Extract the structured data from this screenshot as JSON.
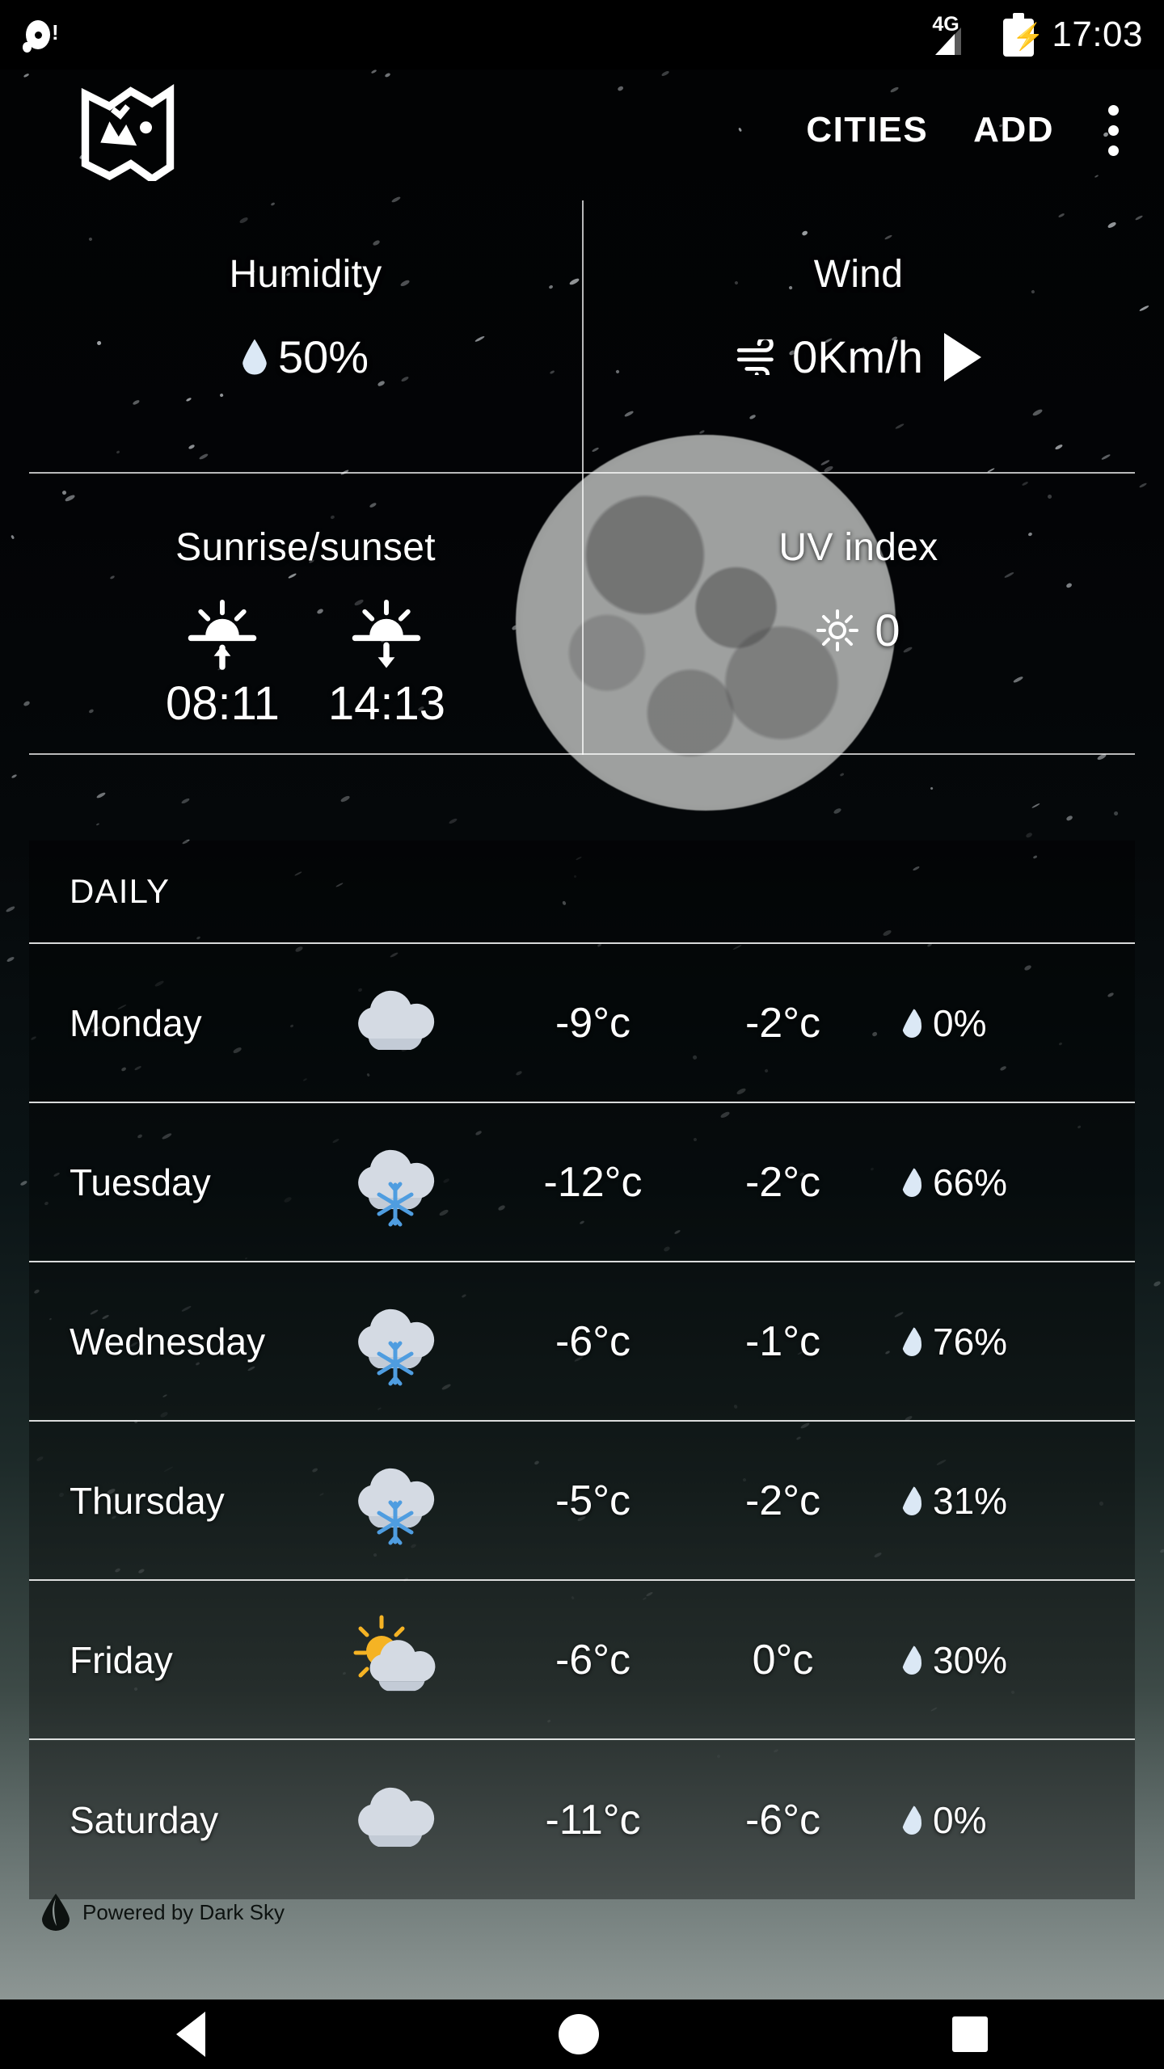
{
  "statusbar": {
    "alarm_icon": "alarm-bell-icon",
    "network": "4G",
    "signal_icon": "cellular-signal-icon",
    "battery_icon": "battery-charging-icon",
    "time": "17:03"
  },
  "appbar": {
    "map_icon": "map-icon",
    "cities_label": "CITIES",
    "add_label": "ADD",
    "overflow_icon": "more-vertical-icon"
  },
  "details": {
    "humidity": {
      "title": "Humidity",
      "icon": "water-drop-icon",
      "value": "50%"
    },
    "wind": {
      "title": "Wind",
      "icon": "wind-icon",
      "value": "0Km/h",
      "direction_icon": "wind-direction-arrow-icon"
    },
    "sun": {
      "title": "Sunrise/sunset",
      "sunrise_icon": "sunrise-icon",
      "sunrise": "08:11",
      "sunset_icon": "sunset-icon",
      "sunset": "14:13"
    },
    "uv": {
      "title": "UV index",
      "icon": "sun-icon",
      "value": "0"
    }
  },
  "daily": {
    "header": "DAILY",
    "rows": [
      {
        "day": "Monday",
        "icon": "cloudy-icon",
        "high": "-9°c",
        "low": "-2°c",
        "precip": "0%"
      },
      {
        "day": "Tuesday",
        "icon": "snow-cloud-icon",
        "high": "-12°c",
        "low": "-2°c",
        "precip": "66%"
      },
      {
        "day": "Wednesday",
        "icon": "snow-cloud-icon",
        "high": "-6°c",
        "low": "-1°c",
        "precip": "76%"
      },
      {
        "day": "Thursday",
        "icon": "snow-cloud-icon",
        "high": "-5°c",
        "low": "-2°c",
        "precip": "31%"
      },
      {
        "day": "Friday",
        "icon": "partly-sunny-icon",
        "high": "-6°c",
        "low": "0°c",
        "precip": "30%"
      },
      {
        "day": "Saturday",
        "icon": "cloudy-icon",
        "high": "-11°c",
        "low": "-6°c",
        "precip": "0%"
      }
    ]
  },
  "footer": {
    "logo_icon": "dark-sky-logo-icon",
    "text": "Powered by Dark Sky"
  },
  "navbar": {
    "back_icon": "back-triangle-icon",
    "home_icon": "home-circle-icon",
    "recents_icon": "recents-square-icon"
  },
  "colors": {
    "accent_drop": "#dbe8f5",
    "snowflake": "#4f9de0",
    "sun": "#f5b324",
    "cloud": "#d4dae3",
    "background_top": "#000000",
    "background_bottom": "#8d9694"
  }
}
